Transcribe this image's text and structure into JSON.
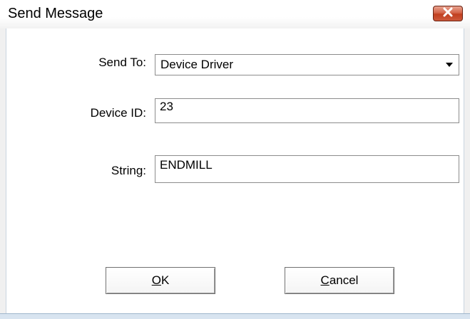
{
  "window": {
    "title": "Send Message",
    "close_icon": "close-x-icon"
  },
  "form": {
    "send_to": {
      "label": "Send To:",
      "value": "Device Driver",
      "dropdown_icon": "chevron-down-icon"
    },
    "device_id": {
      "label": "Device ID:",
      "value": "23"
    },
    "string": {
      "label": "String:",
      "value": "ENDMILL"
    }
  },
  "buttons": {
    "ok": {
      "mnemonic": "O",
      "rest": "K"
    },
    "cancel": {
      "mnemonic": "C",
      "rest": "ancel"
    }
  },
  "colors": {
    "close_button": "#c94a2c",
    "background": "#ffffff"
  }
}
